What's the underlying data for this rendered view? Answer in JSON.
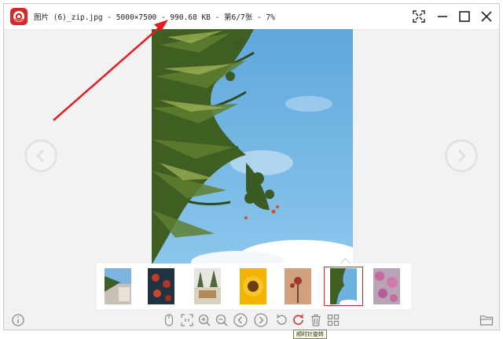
{
  "window": {
    "title": "图片 (6)_zip.jpg - 5000×7500 - 990.68 KB - 第6/7张 - 7%"
  },
  "colors": {
    "accent": "#d9262b",
    "sky": "#6fb1de",
    "toolbar_icon": "#8a8a8a"
  },
  "icons": {
    "app": "app-logo-icon",
    "fit": "fit-screen-icon",
    "minimize": "minimize-icon",
    "maximize": "maximize-icon",
    "close": "close-icon",
    "prev": "chevron-left-icon",
    "next": "chevron-right-icon"
  },
  "thumbnails": [
    {
      "name": "thumb-1",
      "selected": false
    },
    {
      "name": "thumb-2",
      "selected": false
    },
    {
      "name": "thumb-3",
      "selected": false
    },
    {
      "name": "thumb-4",
      "selected": false
    },
    {
      "name": "thumb-5",
      "selected": false
    },
    {
      "name": "thumb-6",
      "selected": true
    },
    {
      "name": "thumb-7",
      "selected": false
    }
  ],
  "toolbar": {
    "tooltip": "顺时针旋转"
  }
}
